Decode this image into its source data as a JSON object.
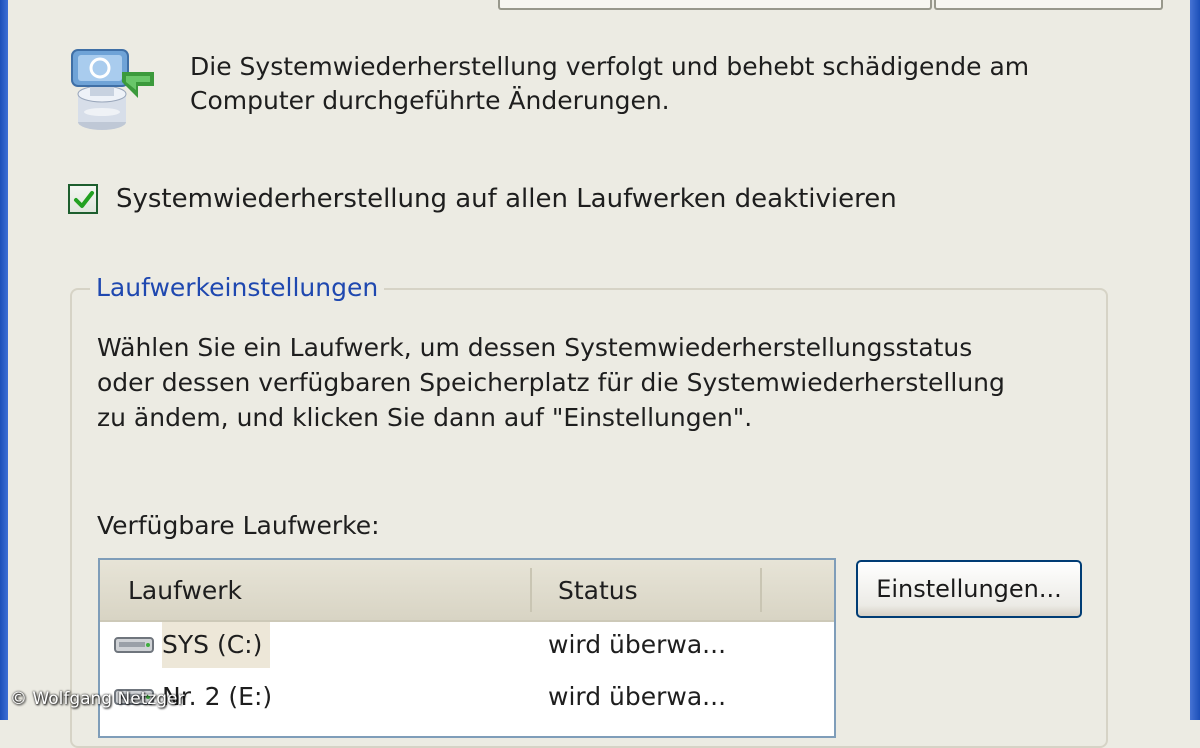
{
  "intro": {
    "line1": "Die Systemwiederherstellung verfolgt und behebt schädigende am",
    "line2": "Computer durchgeführte Änderungen."
  },
  "disable_checkbox": {
    "label": "Systemwiederherstellung auf allen Laufwerken deaktivieren",
    "checked": true
  },
  "drive_settings": {
    "title": "Laufwerkeinstellungen",
    "description": [
      "Wählen Sie ein Laufwerk, um dessen Systemwiederherstellungsstatus",
      "oder dessen verfügbaren Speicherplatz für die Systemwiederherstellung",
      "zu ändem, und klicken Sie dann auf \"Einstellungen\"."
    ],
    "available_label": "Verfügbare Laufwerke:",
    "columns": [
      "Laufwerk",
      "Status"
    ],
    "drives": [
      {
        "name": "SYS (C:)",
        "status": "wird überwa...",
        "selected": true
      },
      {
        "name": "Nr. 2 (E:)",
        "status": "wird überwa...",
        "selected": false
      }
    ],
    "settings_button": "Einstellungen..."
  },
  "credit": "© Wolfgang Netzger",
  "colors": {
    "group_title": "#1f48b0",
    "window_frame": "#1b4fb8",
    "background": "#ecebe3",
    "checkmark": "#21a121"
  },
  "icons": {
    "system_restore": "system-restore-icon",
    "drive": "hard-drive-icon",
    "check": "checkmark-icon"
  }
}
